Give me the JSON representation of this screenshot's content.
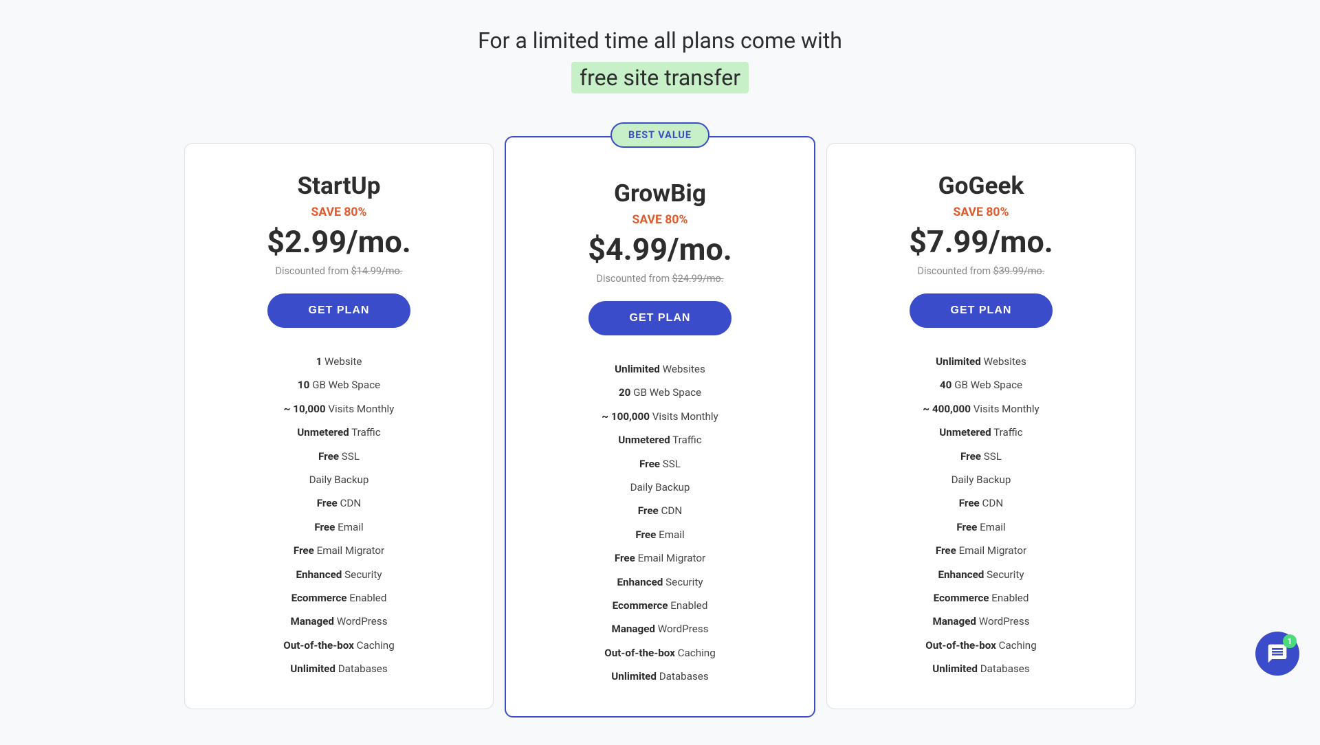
{
  "promo": {
    "line1": "For a limited time all plans come with",
    "line2": "free site transfer"
  },
  "best_value_label": "BEST VALUE",
  "plans": [
    {
      "id": "startup",
      "name": "StartUp",
      "save": "SAVE 80%",
      "price": "$2.99/mo.",
      "discounted_from_label": "Discounted from",
      "original_price": "$14.99/mo.",
      "cta": "GET PLAN",
      "featured": false,
      "features": [
        {
          "bold": "1",
          "normal": " Website"
        },
        {
          "bold": "10",
          "normal": " GB Web Space"
        },
        {
          "bold": "~ 10,000",
          "normal": " Visits Monthly"
        },
        {
          "bold": "Unmetered",
          "normal": " Traffic"
        },
        {
          "bold": "Free",
          "normal": " SSL"
        },
        {
          "bold": "",
          "normal": "Daily Backup"
        },
        {
          "bold": "Free",
          "normal": " CDN"
        },
        {
          "bold": "Free",
          "normal": " Email"
        },
        {
          "bold": "Free",
          "normal": " Email Migrator"
        },
        {
          "bold": "Enhanced",
          "normal": " Security"
        },
        {
          "bold": "Ecommerce",
          "normal": " Enabled"
        },
        {
          "bold": "Managed",
          "normal": " WordPress"
        },
        {
          "bold": "Out-of-the-box",
          "normal": " Caching"
        },
        {
          "bold": "Unlimited",
          "normal": " Databases"
        }
      ]
    },
    {
      "id": "growbig",
      "name": "GrowBig",
      "save": "SAVE 80%",
      "price": "$4.99/mo.",
      "discounted_from_label": "Discounted from",
      "original_price": "$24.99/mo.",
      "cta": "GET PLAN",
      "featured": true,
      "features": [
        {
          "bold": "Unlimited",
          "normal": " Websites"
        },
        {
          "bold": "20",
          "normal": " GB Web Space"
        },
        {
          "bold": "~ 100,000",
          "normal": " Visits Monthly"
        },
        {
          "bold": "Unmetered",
          "normal": " Traffic"
        },
        {
          "bold": "Free",
          "normal": " SSL"
        },
        {
          "bold": "",
          "normal": "Daily Backup"
        },
        {
          "bold": "Free",
          "normal": " CDN"
        },
        {
          "bold": "Free",
          "normal": " Email"
        },
        {
          "bold": "Free",
          "normal": " Email Migrator"
        },
        {
          "bold": "Enhanced",
          "normal": " Security"
        },
        {
          "bold": "Ecommerce",
          "normal": " Enabled"
        },
        {
          "bold": "Managed",
          "normal": " WordPress"
        },
        {
          "bold": "Out-of-the-box",
          "normal": " Caching"
        },
        {
          "bold": "Unlimited",
          "normal": " Databases"
        }
      ]
    },
    {
      "id": "gogeek",
      "name": "GoGeek",
      "save": "SAVE 80%",
      "price": "$7.99/mo.",
      "discounted_from_label": "Discounted from",
      "original_price": "$39.99/mo.",
      "cta": "GET PLAN",
      "featured": false,
      "features": [
        {
          "bold": "Unlimited",
          "normal": " Websites"
        },
        {
          "bold": "40",
          "normal": " GB Web Space"
        },
        {
          "bold": "~ 400,000",
          "normal": " Visits Monthly"
        },
        {
          "bold": "Unmetered",
          "normal": " Traffic"
        },
        {
          "bold": "Free",
          "normal": " SSL"
        },
        {
          "bold": "",
          "normal": "Daily Backup"
        },
        {
          "bold": "Free",
          "normal": " CDN"
        },
        {
          "bold": "Free",
          "normal": " Email"
        },
        {
          "bold": "Free",
          "normal": " Email Migrator"
        },
        {
          "bold": "Enhanced",
          "normal": " Security"
        },
        {
          "bold": "Ecommerce",
          "normal": " Enabled"
        },
        {
          "bold": "Managed",
          "normal": " WordPress"
        },
        {
          "bold": "Out-of-the-box",
          "normal": " Caching"
        },
        {
          "bold": "Unlimited",
          "normal": " Databases"
        }
      ]
    }
  ],
  "chat": {
    "badge_count": "1"
  }
}
